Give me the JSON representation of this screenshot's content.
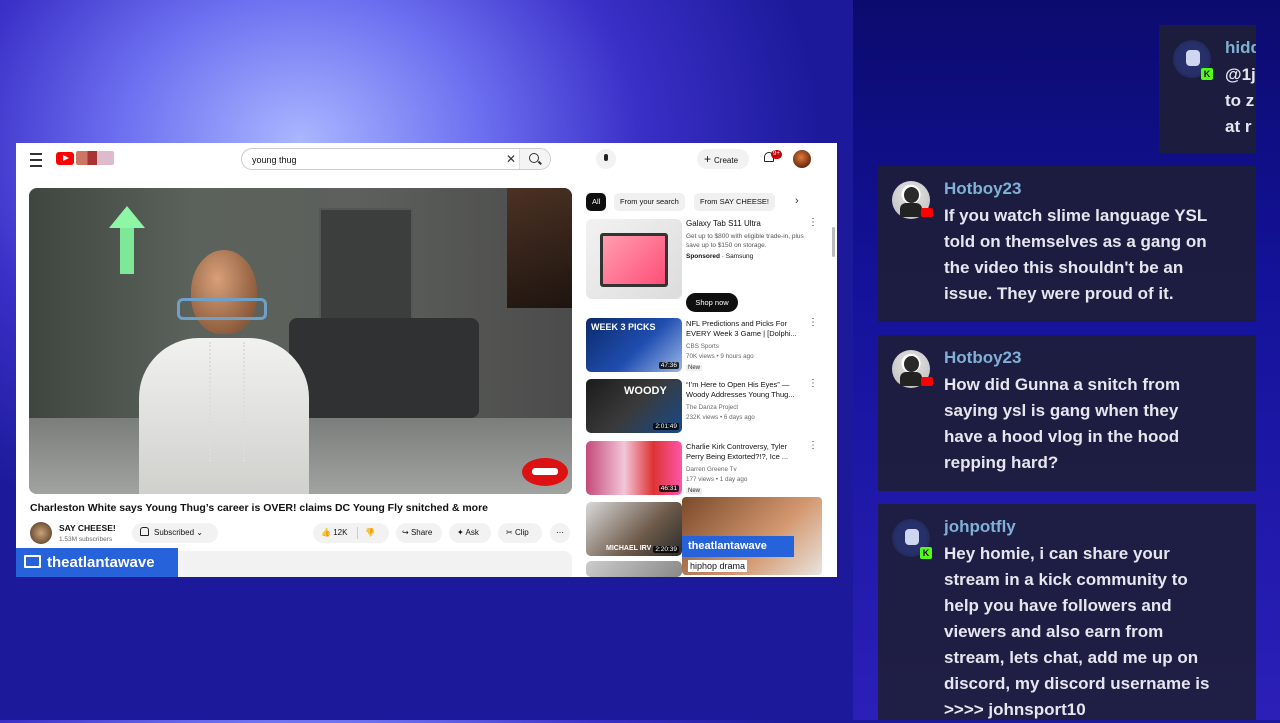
{
  "youtube": {
    "search_value": "young thug",
    "create_label": "Create",
    "notif_count": "9+",
    "video": {
      "title": "Charleston White says Young Thug’s career is OVER! claims DC Young Fly snitched & more",
      "channel": "SAY CHEESE!",
      "subscribers": "1.53M subscribers",
      "subscribed_label": "Subscribed",
      "likes": "12K",
      "share_label": "Share",
      "ask_label": "Ask",
      "clip_label": "Clip"
    },
    "chips": [
      "All",
      "From your search",
      "From SAY CHEESE!"
    ],
    "ad": {
      "title": "Galaxy Tab S11 Ultra",
      "desc": "Get up to $800 with eligible trade-in, plus save up to $150 on storage.",
      "sponsored": "Sponsored",
      "brand": "Samsung",
      "cta": "Shop now"
    },
    "recommended": [
      {
        "title": "NFL Predictions and Picks For EVERY Week 3 Game | [Dolphi...",
        "channel": "CBS Sports",
        "meta": "70K views • 9 hours ago",
        "duration": "47:36",
        "badge": "New",
        "thumb_text": "WEEK 3 PICKS"
      },
      {
        "title": "“I’m Here to Open His Eyes” — Woody Addresses Young Thug...",
        "channel": "The Danza Project",
        "meta": "232K views • 6 days ago",
        "duration": "2:01:49",
        "badge": "",
        "thumb_text": "WOODY"
      },
      {
        "title": "Charlie Kirk Controversy, Tyler Perry Being Extorted?!?, Ice ...",
        "channel": "Darren Greene Tv",
        "meta": "177 views • 1 day ago",
        "duration": "46:31",
        "badge": "New",
        "thumb_text": ""
      },
      {
        "title": "",
        "channel": "",
        "meta": "",
        "duration": "2:20:39",
        "badge": "",
        "thumb_text": "MICHAEL IRV"
      }
    ],
    "cam_caption": "hiphop drama"
  },
  "stream": {
    "source_label": "theatlantawave",
    "cam_label": "theatlantawave"
  },
  "chat": [
    {
      "user": "hidd",
      "lines": [
        "@1j",
        "to z",
        "at r"
      ],
      "platform": "kick"
    },
    {
      "user": "Hotboy23",
      "lines": [
        "If you watch slime language YSL",
        "told on themselves as a gang on",
        "the video this shouldn't be an",
        "issue. They were proud of it."
      ],
      "platform": "youtube"
    },
    {
      "user": "Hotboy23",
      "lines": [
        "How did Gunna a snitch from",
        "saying ysl is gang when they",
        "have a hood vlog in the hood",
        "repping hard?"
      ],
      "platform": "youtube"
    },
    {
      "user": "johpotfly",
      "lines": [
        "Hey homie, i can share your",
        "stream in a kick community to",
        "help you have followers and",
        "viewers and also earn from",
        "stream, lets chat, add me up on",
        "discord, my discord username is",
        ">>>> johnsport10"
      ],
      "platform": "kick"
    }
  ],
  "colors": {
    "accent": "#2662d9",
    "kick": "#53fc18",
    "chat_user": "#7fb0d6",
    "youtube_red": "#ff0000"
  },
  "icons": [
    "menu-icon",
    "search-icon",
    "clear-icon",
    "mic-icon",
    "bell-icon",
    "monitor-icon",
    "like-icon",
    "dislike-icon",
    "share-icon",
    "sparkle-icon",
    "scissors-icon",
    "kick-icon",
    "youtube-icon"
  ]
}
